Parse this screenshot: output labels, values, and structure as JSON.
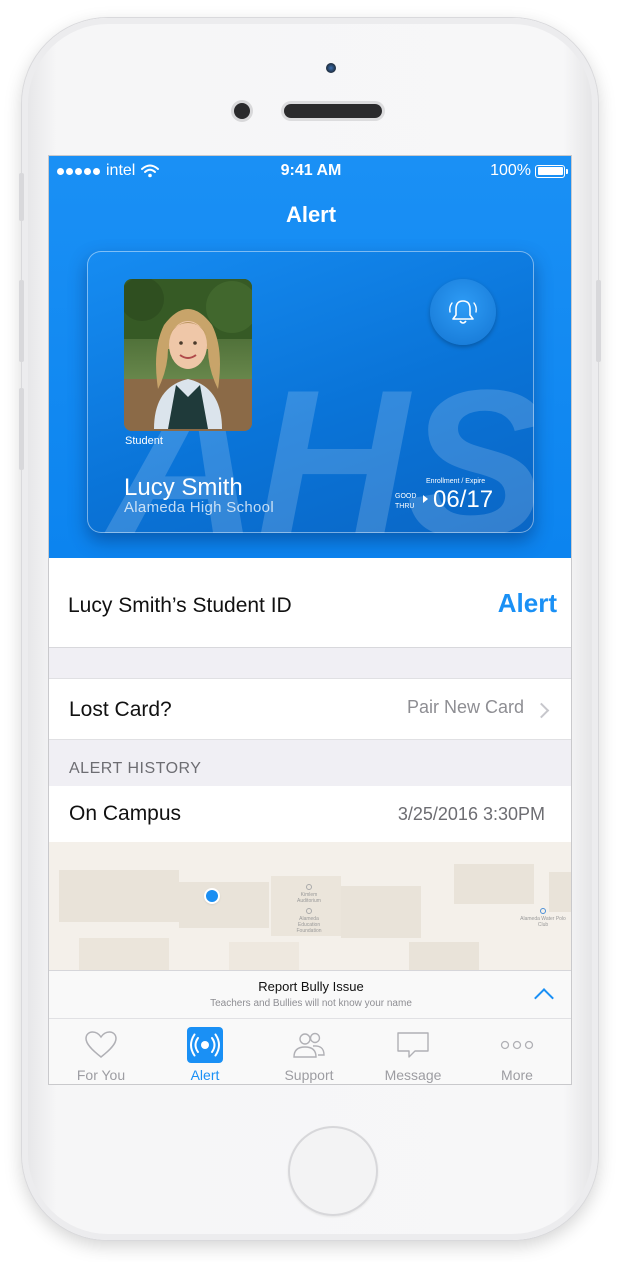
{
  "status_bar": {
    "carrier": "intel",
    "time": "9:41 AM",
    "battery": "100%"
  },
  "nav": {
    "title": "Alert"
  },
  "id_card": {
    "photo_caption": "Student",
    "student_name": "Lucy Smith",
    "school_name": "Alameda High School",
    "watermark": "AHS",
    "good_thru_line1": "GOOD",
    "good_thru_line2": "THRU",
    "expire_caption": "Enrollment / Expire",
    "expire_date": "06/17",
    "alert_icon": "bell-ringing-icon"
  },
  "student_id_row": {
    "label": "Lucy Smith’s Student ID",
    "action": "Alert"
  },
  "lost_card_row": {
    "label": "Lost Card?",
    "detail": "Pair New Card"
  },
  "alert_history": {
    "header": "ALERT HISTORY",
    "items": [
      {
        "label": "On Campus",
        "timestamp": "3/25/2016 3:30PM"
      }
    ]
  },
  "map": {
    "poi_1": "Kimlem Auditorium",
    "poi_2": "Alameda Education Foundation",
    "poi_3": "Alameda Water Polo Club"
  },
  "report_bar": {
    "title": "Report Bully Issue",
    "subtitle": "Teachers and Bullies will not know your name"
  },
  "tab_bar": {
    "tabs": [
      {
        "label": "For You",
        "icon": "heart-icon",
        "active": false
      },
      {
        "label": "Alert",
        "icon": "alert-broadcast-icon",
        "active": true
      },
      {
        "label": "Support",
        "icon": "people-icon",
        "active": false
      },
      {
        "label": "Message",
        "icon": "message-bubble-icon",
        "active": false
      },
      {
        "label": "More",
        "icon": "more-dots-icon",
        "active": false
      }
    ]
  },
  "colors": {
    "accent": "#1a90f5",
    "hero_background": "#0c84ef",
    "inactive_tab": "#9d9da2"
  }
}
